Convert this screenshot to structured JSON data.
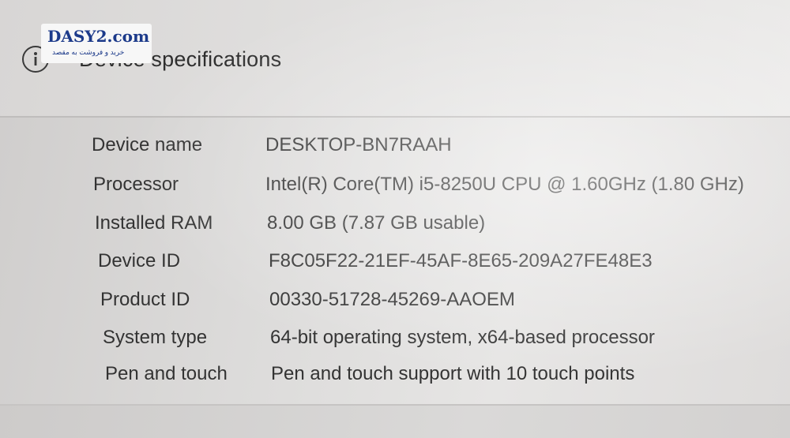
{
  "header": {
    "title": "Device specifications",
    "icon": "info-icon"
  },
  "watermark": {
    "brand": "DASY2.com",
    "tagline": "خرید و فروشت به مقصد"
  },
  "specs": [
    {
      "label": "Device name",
      "value": "DESKTOP-BN7RAAH"
    },
    {
      "label": "Processor",
      "value": "Intel(R) Core(TM) i5-8250U CPU @ 1.60GHz   (1.80 GHz)"
    },
    {
      "label": "Installed RAM",
      "value": "8.00 GB (7.87 GB usable)"
    },
    {
      "label": "Device ID",
      "value": "F8C05F22-21EF-45AF-8E65-209A27FE48E3"
    },
    {
      "label": "Product ID",
      "value": "00330-51728-45269-AAOEM"
    },
    {
      "label": "System type",
      "value": "64-bit operating system, x64-based processor"
    },
    {
      "label": "Pen and touch",
      "value": "Pen and touch support with 10 touch points"
    }
  ],
  "colors": {
    "text": "#2b2b2b",
    "watermark": "#1c3a8a"
  }
}
